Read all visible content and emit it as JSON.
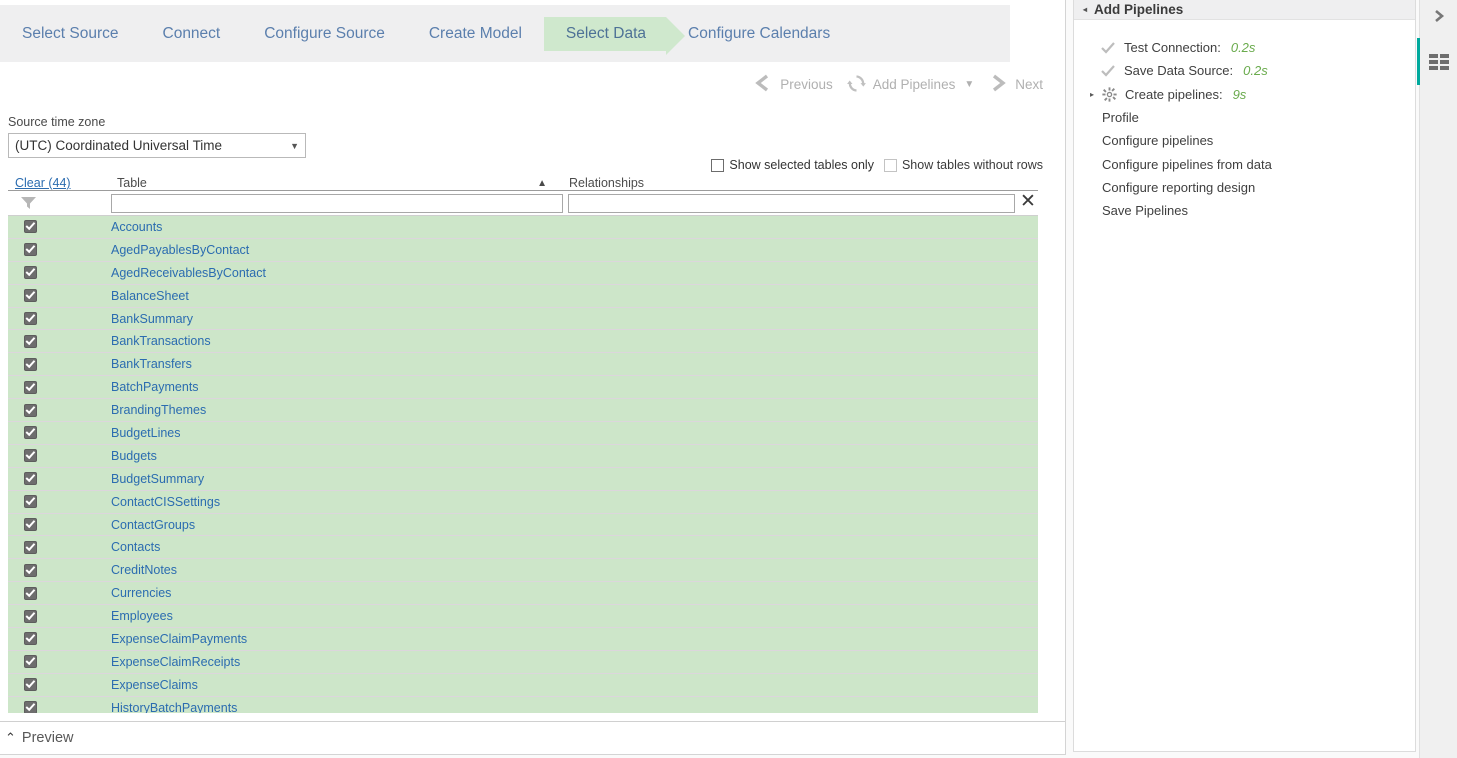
{
  "wizard": {
    "steps": [
      {
        "label": "Select Source",
        "active": false
      },
      {
        "label": "Connect",
        "active": false
      },
      {
        "label": "Configure Source",
        "active": false
      },
      {
        "label": "Create Model",
        "active": false
      },
      {
        "label": "Select Data",
        "active": true
      },
      {
        "label": "Configure Calendars",
        "active": false
      }
    ]
  },
  "toolbar": {
    "previous_label": "Previous",
    "add_pipelines_label": "Add Pipelines",
    "next_label": "Next",
    "caret": "▼"
  },
  "timezone": {
    "label": "Source time zone",
    "value": "(UTC) Coordinated Universal Time",
    "caret": "▼"
  },
  "options": [
    {
      "label": "Show selected tables only",
      "checked": false,
      "disabled": false
    },
    {
      "label": "Show tables without rows",
      "checked": false,
      "disabled": true
    }
  ],
  "grid": {
    "clear_label": "Clear (44)",
    "col_table": "Table",
    "col_relationships": "Relationships",
    "sort_indicator": "▲",
    "filter_table_value": "",
    "filter_relationships_value": "",
    "clear_filter_icon": "✕",
    "rows": [
      {
        "name": "Accounts",
        "checked": true,
        "relationships": ""
      },
      {
        "name": "AgedPayablesByContact",
        "checked": true,
        "relationships": ""
      },
      {
        "name": "AgedReceivablesByContact",
        "checked": true,
        "relationships": ""
      },
      {
        "name": "BalanceSheet",
        "checked": true,
        "relationships": ""
      },
      {
        "name": "BankSummary",
        "checked": true,
        "relationships": ""
      },
      {
        "name": "BankTransactions",
        "checked": true,
        "relationships": ""
      },
      {
        "name": "BankTransfers",
        "checked": true,
        "relationships": ""
      },
      {
        "name": "BatchPayments",
        "checked": true,
        "relationships": ""
      },
      {
        "name": "BrandingThemes",
        "checked": true,
        "relationships": ""
      },
      {
        "name": "BudgetLines",
        "checked": true,
        "relationships": ""
      },
      {
        "name": "Budgets",
        "checked": true,
        "relationships": ""
      },
      {
        "name": "BudgetSummary",
        "checked": true,
        "relationships": ""
      },
      {
        "name": "ContactCISSettings",
        "checked": true,
        "relationships": ""
      },
      {
        "name": "ContactGroups",
        "checked": true,
        "relationships": ""
      },
      {
        "name": "Contacts",
        "checked": true,
        "relationships": ""
      },
      {
        "name": "CreditNotes",
        "checked": true,
        "relationships": ""
      },
      {
        "name": "Currencies",
        "checked": true,
        "relationships": ""
      },
      {
        "name": "Employees",
        "checked": true,
        "relationships": ""
      },
      {
        "name": "ExpenseClaimPayments",
        "checked": true,
        "relationships": ""
      },
      {
        "name": "ExpenseClaimReceipts",
        "checked": true,
        "relationships": ""
      },
      {
        "name": "ExpenseClaims",
        "checked": true,
        "relationships": ""
      },
      {
        "name": "HistoryBatchPayments",
        "checked": true,
        "relationships": ""
      }
    ]
  },
  "preview": {
    "label": "Preview",
    "chevron": "⌃"
  },
  "right_panel": {
    "title": "Add Pipelines",
    "triangle": "◂",
    "items": [
      {
        "label": "Test Connection:",
        "time": "0.2s",
        "icon": "check-icon",
        "expandable": false
      },
      {
        "label": "Save Data Source:",
        "time": "0.2s",
        "icon": "check-icon",
        "expandable": false
      },
      {
        "label": "Create pipelines:",
        "time": "9s",
        "icon": "gear-icon",
        "expandable": true
      },
      {
        "label": "Profile",
        "time": "",
        "icon": "none",
        "expandable": false
      },
      {
        "label": "Configure pipelines",
        "time": "",
        "icon": "none",
        "expandable": false
      },
      {
        "label": "Configure pipelines from data",
        "time": "",
        "icon": "none",
        "expandable": false
      },
      {
        "label": "Configure reporting design",
        "time": "",
        "icon": "none",
        "expandable": false
      },
      {
        "label": "Save Pipelines",
        "time": "",
        "icon": "none",
        "expandable": false
      }
    ]
  },
  "rail": {
    "collapse_icon": "›",
    "panel_tab_icon": "list-grid-icon",
    "accent_color": "#00a99d"
  },
  "colors": {
    "selected_row_green": "#cde6c9",
    "link_blue": "#2b6cb0",
    "step_blue": "#5b7fad",
    "time_green": "#6aab4d",
    "header_gray": "#efeff0"
  }
}
